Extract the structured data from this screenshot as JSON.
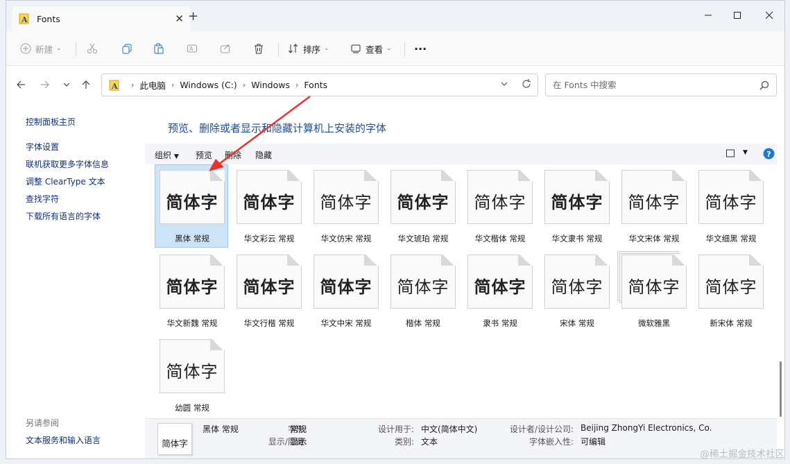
{
  "window": {
    "tab_title": "Fonts",
    "new_tab": "+"
  },
  "toolbar": {
    "new_label": "新建",
    "sort_label": "排序",
    "view_label": "查看",
    "more_label": "···"
  },
  "address": {
    "crumbs": [
      "此电脑",
      "Windows (C:)",
      "Windows",
      "Fonts"
    ]
  },
  "search": {
    "placeholder": "在 Fonts 中搜索"
  },
  "left_pane": {
    "home_link": "控制面板主页",
    "links": [
      "字体设置",
      "联机获取更多字体信息",
      "调整 ClearType 文本",
      "查找字符",
      "下载所有语言的字体"
    ],
    "see_also_title": "另请参阅",
    "see_also_link": "文本服务和输入语言"
  },
  "content": {
    "heading": "预览、删除或者显示和隐藏计算机上安装的字体",
    "commands": {
      "organize": "组织",
      "preview": "预览",
      "delete": "删除",
      "hide": "隐藏"
    }
  },
  "fonts": [
    {
      "name": "黑体 常规",
      "preview": "简体字",
      "selected": true
    },
    {
      "name": "华文彩云 常规",
      "preview": "简体字"
    },
    {
      "name": "华文仿宋 常规",
      "preview": "简体字"
    },
    {
      "name": "华文琥珀 常规",
      "preview": "简体字"
    },
    {
      "name": "华文楷体 常规",
      "preview": "简体字"
    },
    {
      "name": "华文隶书 常规",
      "preview": "简体字"
    },
    {
      "name": "华文宋体 常规",
      "preview": "简体字"
    },
    {
      "name": "华文细黑 常规",
      "preview": "简体字"
    },
    {
      "name": "华文新魏 常规",
      "preview": "简体字"
    },
    {
      "name": "华文行楷 常规",
      "preview": "简体字"
    },
    {
      "name": "华文中宋 常规",
      "preview": "简体字"
    },
    {
      "name": "楷体 常规",
      "preview": "简体字"
    },
    {
      "name": "隶书 常规",
      "preview": "简体字"
    },
    {
      "name": "宋体 常规",
      "preview": "简体字"
    },
    {
      "name": "微软雅黑",
      "preview": "简体字",
      "family_stack": true
    },
    {
      "name": "新宋体 常规",
      "preview": "简体字"
    },
    {
      "name": "幼圆 常规",
      "preview": "简体字"
    }
  ],
  "details": {
    "preview": "简体字",
    "name": "黑体 常规",
    "style_key": "字形:",
    "style_val": "常规",
    "show_key": "显示/隐藏:",
    "show_val": "显示",
    "designed_key": "设计用于:",
    "designed_val": "中文(简体中文)",
    "category_key": "类别:",
    "category_val": "文本",
    "designer_key": "设计者/设计公司:",
    "designer_val": "Beijing ZhongYi Electronics, Co.",
    "embed_key": "字体嵌入性:",
    "embed_val": "可编辑"
  },
  "watermark": "@稀土掘金技术社区",
  "colors": {
    "accent": "#1e4e9c",
    "link": "#10307a",
    "selection": "#cce4f7",
    "arrow": "#e8312a"
  },
  "icons": [
    "font-folder-icon",
    "close-icon",
    "minimize-icon",
    "maximize-icon",
    "plus-icon",
    "cut-icon",
    "copy-icon",
    "paste-icon",
    "rename-icon",
    "share-icon",
    "trash-icon",
    "sort-icon",
    "view-icon",
    "back-icon",
    "forward-icon",
    "up-icon",
    "refresh-icon",
    "search-icon",
    "help-icon"
  ]
}
